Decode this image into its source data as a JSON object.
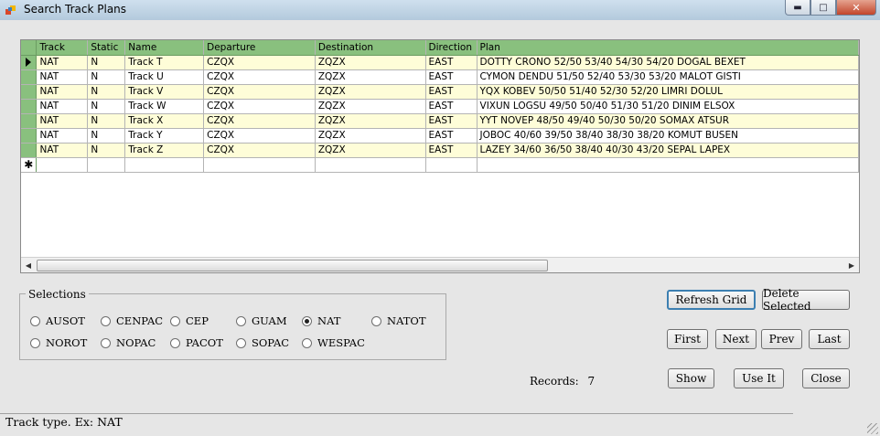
{
  "window": {
    "title": "Search Track Plans"
  },
  "grid": {
    "columns": [
      "Track",
      "Static",
      "Name",
      "Departure",
      "Destination",
      "Direction",
      "Plan"
    ],
    "rows": [
      [
        "NAT",
        "N",
        "Track T",
        "CZQX",
        "ZQZX",
        "EAST",
        "DOTTY CRONO 52/50 53/40 54/30 54/20 DOGAL BEXET"
      ],
      [
        "NAT",
        "N",
        "Track U",
        "CZQX",
        "ZQZX",
        "EAST",
        "CYMON DENDU 51/50 52/40 53/30 53/20 MALOT GISTI"
      ],
      [
        "NAT",
        "N",
        "Track V",
        "CZQX",
        "ZQZX",
        "EAST",
        "YQX KOBEV 50/50 51/40 52/30 52/20 LIMRI DOLUL"
      ],
      [
        "NAT",
        "N",
        "Track W",
        "CZQX",
        "ZQZX",
        "EAST",
        "VIXUN LOGSU 49/50 50/40 51/30 51/20 DINIM ELSOX"
      ],
      [
        "NAT",
        "N",
        "Track X",
        "CZQX",
        "ZQZX",
        "EAST",
        "YYT NOVEP 48/50 49/40 50/30 50/20 SOMAX ATSUR"
      ],
      [
        "NAT",
        "N",
        "Track Y",
        "CZQX",
        "ZQZX",
        "EAST",
        "JOBOC 40/60 39/50 38/40 38/30 38/20 KOMUT BUSEN"
      ],
      [
        "NAT",
        "N",
        "Track Z",
        "CZQX",
        "ZQZX",
        "EAST",
        "LAZEY 34/60 36/50 38/40 40/30 43/20 SEPAL LAPEX"
      ]
    ],
    "new_row_marker": "✱"
  },
  "selections": {
    "legend": "Selections",
    "selected": "NAT",
    "options": [
      "AUSOT",
      "CENPAC",
      "CEP",
      "GUAM",
      "NAT",
      "NATOT",
      "NOROT",
      "NOPAC",
      "PACOT",
      "SOPAC",
      "WESPAC"
    ]
  },
  "buttons": {
    "refresh_grid": "Refresh Grid",
    "delete_selected": "Delete Selected",
    "first": "First",
    "next": "Next",
    "prev": "Prev",
    "last": "Last",
    "show": "Show",
    "use_it": "Use It",
    "close": "Close"
  },
  "records": {
    "label": "Records:",
    "count": "7"
  },
  "status": {
    "text": "Track type. Ex: NAT"
  }
}
